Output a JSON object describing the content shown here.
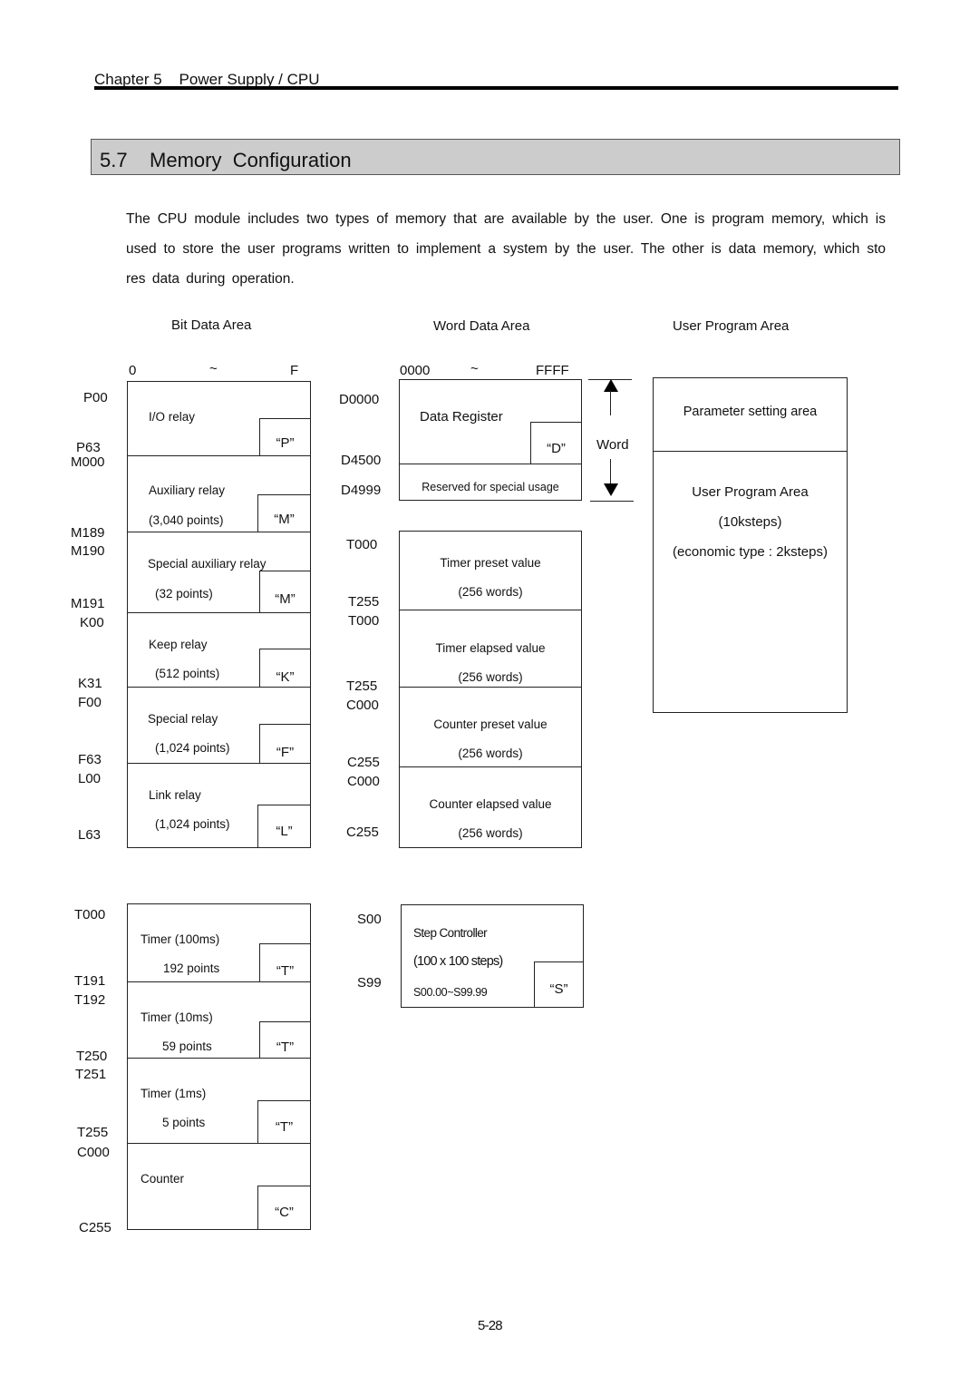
{
  "header": {
    "chapter": "Chapter 5    Power Supply / CPU"
  },
  "section": {
    "title": "5.7    Memory  Configuration"
  },
  "intro": {
    "text": "The CPU module includes two types of memory that are available by the user. One is program memory, which is used to store the user programs written to implement a system by the user. The other is data memory, which sto res data during operation."
  },
  "bit_area": {
    "title": "Bit Data Area",
    "range": {
      "start": "0",
      "sep": "~",
      "end": "F"
    },
    "blocks": [
      {
        "name": "I/O relay",
        "points": "",
        "tag": "“P”",
        "start": "P00",
        "end": "P63"
      },
      {
        "name": "Auxiliary relay",
        "points": "(3,040 points)",
        "tag": "“M”",
        "start": "M000",
        "end": "M189"
      },
      {
        "name": "Special auxiliary relay",
        "points": "(32 points)",
        "tag": "“M”",
        "start": "M190",
        "end": "M191"
      },
      {
        "name": "Keep relay",
        "points": "(512 points)",
        "tag": "“K”",
        "start": "K00",
        "end": "K31"
      },
      {
        "name": "Special relay",
        "points": "(1,024 points)",
        "tag": "“F”",
        "start": "F00",
        "end": "F63"
      },
      {
        "name": "Link relay",
        "points": "(1,024 points)",
        "tag": "“L”",
        "start": "L00",
        "end": "L63"
      }
    ],
    "timer_blocks": [
      {
        "name": "Timer (100ms)",
        "points": "192 points",
        "tag": "“T”",
        "start": "T000",
        "end": "T191"
      },
      {
        "name": "Timer (10ms)",
        "points": "59 points",
        "tag": "“T”",
        "start": "T192",
        "end": "T250"
      },
      {
        "name": "Timer (1ms)",
        "points": "5 points",
        "tag": "“T”",
        "start": "T251",
        "end": "T255"
      },
      {
        "name": "Counter",
        "points": "",
        "tag": "“C”",
        "start": "C000",
        "end": "C255"
      }
    ]
  },
  "word_area": {
    "title": "Word Data Area",
    "range": {
      "start": "0000",
      "sep": "~",
      "end": "FFFF"
    },
    "data_register": {
      "name": "Data Register",
      "tag": "“D”",
      "start": "D0000",
      "mid": "D4500",
      "end": "D4999",
      "reserved": "Reserved for special usage"
    },
    "word_label": "Word",
    "blocks": [
      {
        "name": "Timer preset value",
        "words": "(256 words)",
        "start": "T000",
        "end": "T255"
      },
      {
        "name": "Timer elapsed value",
        "words": "(256 words)",
        "start": "T000",
        "end": "T255"
      },
      {
        "name": "Counter preset value",
        "words": "(256 words)",
        "start": "C000",
        "end": "C255"
      },
      {
        "name": "Counter elapsed value",
        "words": "(256 words)",
        "start": "C000",
        "end": "C255"
      }
    ],
    "step": {
      "name": "Step Controller",
      "steps": "(100 x 100 steps)",
      "range": "S00.00~S99.99",
      "tag": "“S”",
      "start": "S00",
      "end": "S99"
    }
  },
  "program_area": {
    "title": "User Program Area",
    "param": "Parameter setting area",
    "body_title": "User Program Area",
    "capacity": "(10ksteps)",
    "economic": "(economic type : 2ksteps)"
  },
  "footer": {
    "page_number": "5-28"
  }
}
